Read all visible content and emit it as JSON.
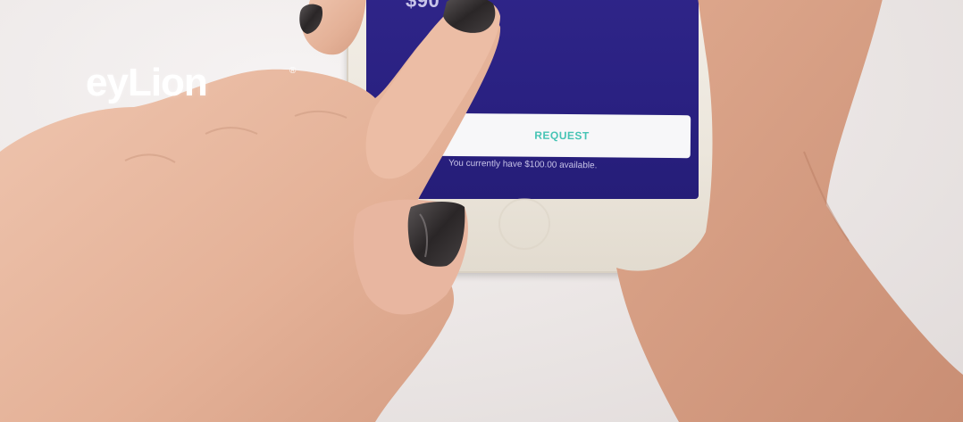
{
  "phone": {
    "amount": "$90",
    "request_label": "REQUEST",
    "available_text": "You currently have $100.00 available."
  },
  "logo": {
    "text": "eyLion",
    "registered": "®"
  },
  "colors": {
    "screen": "#2a2182",
    "button": "#f7f7f9",
    "button_text": "#47c4b5",
    "background": "#ece8e7",
    "skin": "#e8b9a0",
    "nail": "#2a2627"
  }
}
